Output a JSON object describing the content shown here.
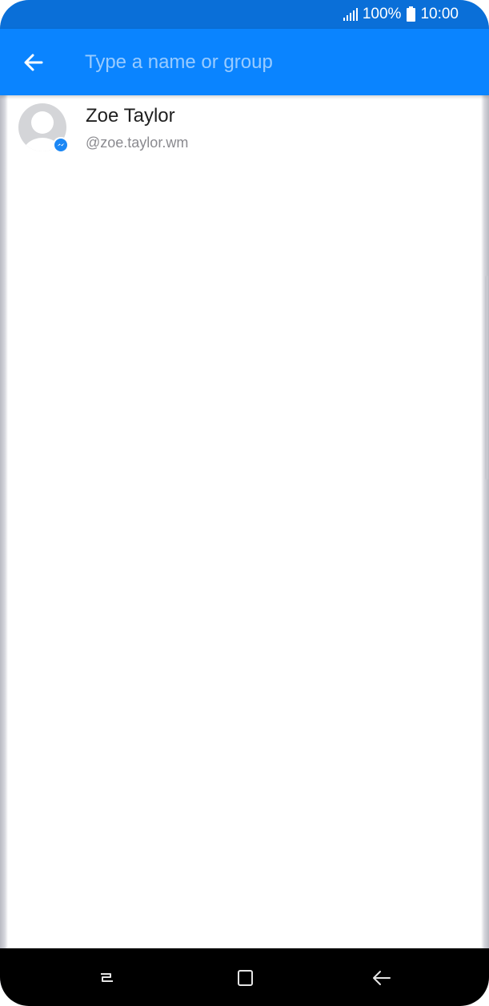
{
  "status_bar": {
    "battery_percent": "100%",
    "time": "10:00",
    "signal_icon": "signal-icon",
    "battery_icon": "battery-icon"
  },
  "search": {
    "placeholder": "Type a name or group",
    "value": "",
    "back_icon": "arrow-back-icon"
  },
  "results": [
    {
      "name": "Zoe Taylor",
      "handle": "@zoe.taylor.wm",
      "avatar_icon": "default-avatar-icon",
      "badge_icon": "messenger-badge-icon"
    }
  ],
  "navigation_bar": {
    "buttons": [
      "recent-apps-icon",
      "home-icon",
      "back-icon"
    ]
  },
  "colors": {
    "status_bar": "#0a6fd8",
    "app_bar": "#0a84ff",
    "accent": "#1b87f5",
    "background": "#ffffff",
    "navigation_bar": "#000000"
  }
}
